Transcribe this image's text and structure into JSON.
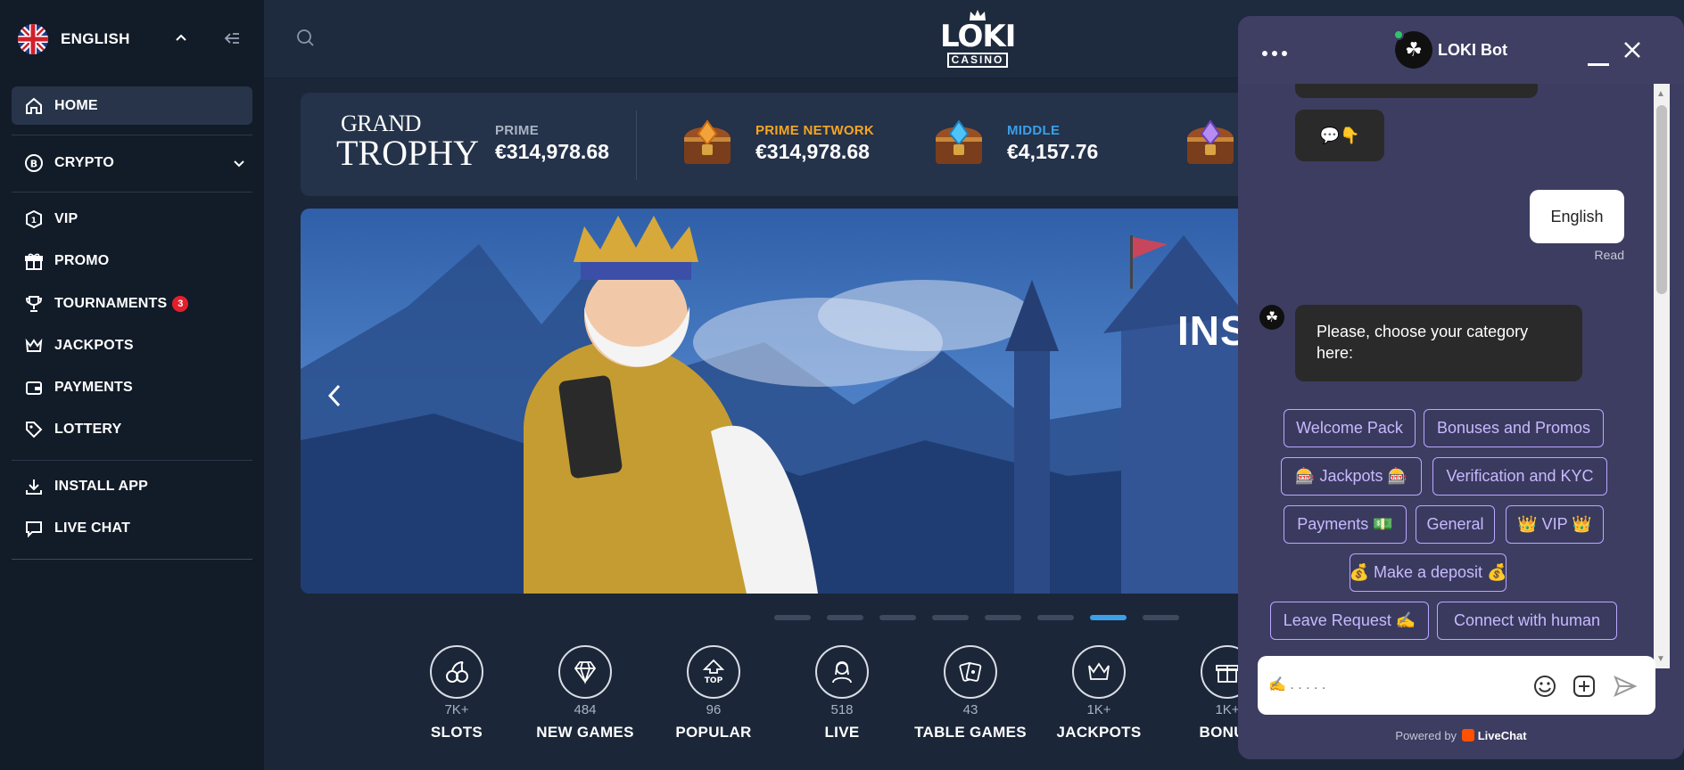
{
  "sidebar": {
    "language": "ENGLISH",
    "items": [
      {
        "label": "HOME"
      },
      {
        "label": "CRYPTO"
      },
      {
        "label": "VIP"
      },
      {
        "label": "PROMO"
      },
      {
        "label": "TOURNAMENTS",
        "badge": "3"
      },
      {
        "label": "JACKPOTS"
      },
      {
        "label": "PAYMENTS"
      },
      {
        "label": "LOTTERY"
      },
      {
        "label": "INSTALL APP"
      },
      {
        "label": "LIVE CHAT"
      }
    ]
  },
  "header": {
    "logo_top": "LOKI",
    "logo_bottom": "CASINO"
  },
  "jackpots": {
    "grand_line1": "GRAND",
    "grand_line2": "TROPHY",
    "prime_title": "PRIME",
    "prime_value": "€314,978.68",
    "network_title": "PRIME NETWORK",
    "network_value": "€314,978.68",
    "middle_title": "MIDDLE",
    "middle_value": "€4,157.76"
  },
  "banner": {
    "headline": "INS"
  },
  "categories": [
    {
      "label": "SLOTS",
      "count": "7K+",
      "icon": "cherries-icon"
    },
    {
      "label": "NEW GAMES",
      "count": "484",
      "icon": "diamond-icon"
    },
    {
      "label": "POPULAR",
      "count": "96",
      "icon": "top-arrow-icon"
    },
    {
      "label": "LIVE",
      "count": "518",
      "icon": "dealer-icon"
    },
    {
      "label": "TABLE GAMES",
      "count": "43",
      "icon": "cards-icon"
    },
    {
      "label": "JACKPOTS",
      "count": "1K+",
      "icon": "crown-icon"
    },
    {
      "label": "BONUS",
      "count": "1K+",
      "icon": "gift-icon"
    }
  ],
  "colors": {
    "accent_gold": "#f5a623",
    "accent_blue": "#3aa0e8",
    "chat_bg": "#3d3d62",
    "quick_reply": "#b9a8ff"
  },
  "chat": {
    "bot_name": "LOKI Bot",
    "emoji_reply": "💬👇",
    "user_message": "English",
    "read_status": "Read",
    "bot_message": "Please, choose your category here:",
    "quick_replies": [
      "Welcome Pack",
      "Bonuses and Promos",
      "🎰 Jackpots 🎰",
      "Verification and KYC",
      "Payments 💵",
      "General",
      "👑 VIP 👑",
      "💰 Make a deposit 💰",
      "Leave Request ✍️",
      "Connect with human"
    ],
    "composer_placeholder": "✍️ . . . . .",
    "powered_by": "Powered by",
    "powered_brand": "LiveChat"
  }
}
